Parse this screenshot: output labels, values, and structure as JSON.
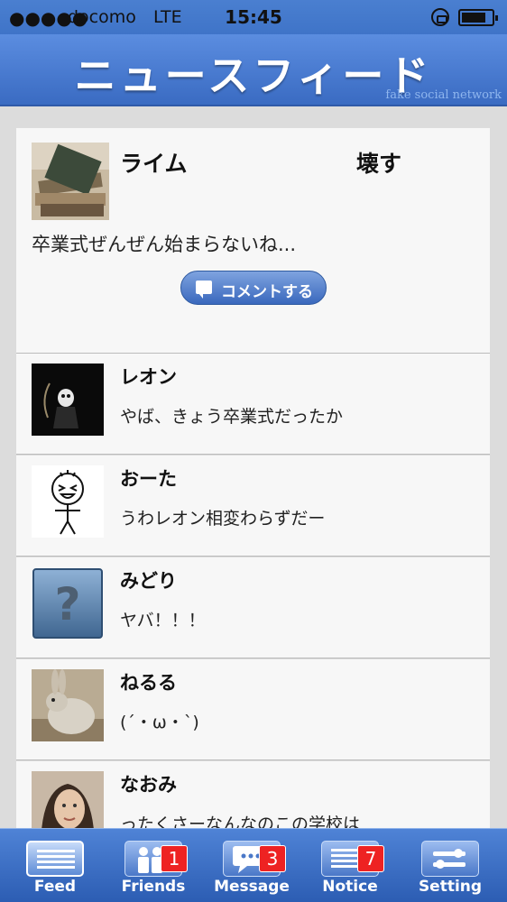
{
  "status_bar": {
    "signal": "●●●●●",
    "carrier": "docomo",
    "network": "LTE",
    "time": "15:45"
  },
  "nav": {
    "title": "ニュースフィード",
    "subtitle": "fake social network"
  },
  "main_post": {
    "name": "ライム",
    "action": "壊す",
    "text": "卒業式ぜんぜん始まらないね...",
    "comment_button": "コメントする"
  },
  "feed": [
    {
      "name": "レオン",
      "message": "やば、きょう卒業式だったか"
    },
    {
      "name": "おーた",
      "message": "うわレオン相変わらずだー"
    },
    {
      "name": "みどり",
      "message": "ヤバ！！！"
    },
    {
      "name": "ねるる",
      "message": "(´・ω・`)"
    },
    {
      "name": "なおみ",
      "message": "ったくさーなんなのこの学校は"
    }
  ],
  "tabs": [
    {
      "label": "Feed",
      "badge": ""
    },
    {
      "label": "Friends",
      "badge": "1"
    },
    {
      "label": "Message",
      "badge": "3"
    },
    {
      "label": "Notice",
      "badge": "7"
    },
    {
      "label": "Setting",
      "badge": ""
    }
  ],
  "colors": {
    "bar_blue": "#3f74c8",
    "badge_red": "#e22222"
  }
}
